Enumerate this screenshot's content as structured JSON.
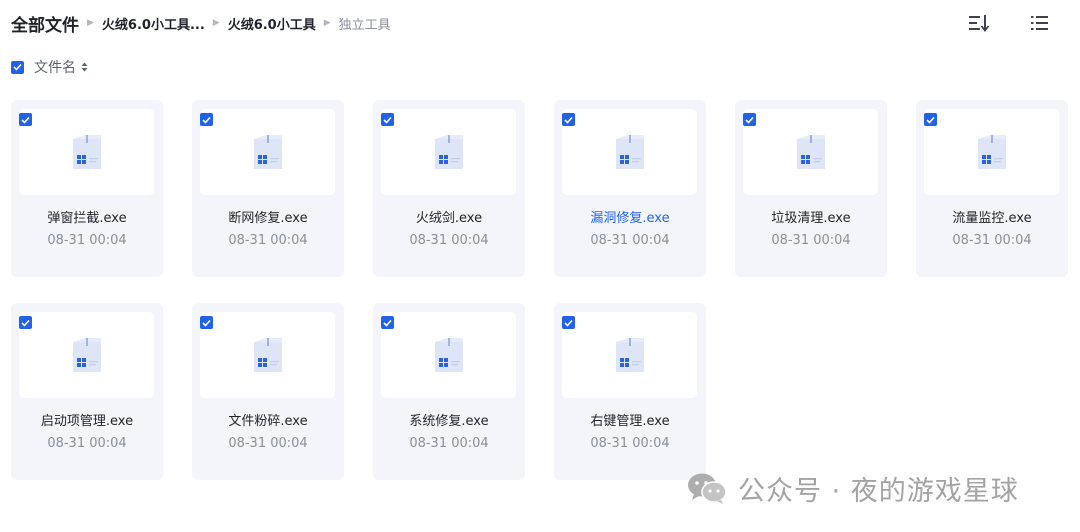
{
  "breadcrumb": {
    "root": "全部文件",
    "items": [
      "火绒6.0小工具...",
      "火绒6.0小工具",
      "独立工具"
    ]
  },
  "toolbar": {
    "sort_icon": "sort-order-icon",
    "view_icon": "list-view-icon"
  },
  "list_header": {
    "checkbox_checked": true,
    "column_label": "文件名"
  },
  "colors": {
    "accent": "#2162e8",
    "card_bg": "#f3f5fb",
    "muted_text": "#8a8f99"
  },
  "files": [
    {
      "name": "弹窗拦截.exe",
      "date": "08-31 00:04",
      "checked": true
    },
    {
      "name": "断网修复.exe",
      "date": "08-31 00:04",
      "checked": true
    },
    {
      "name": "火绒剑.exe",
      "date": "08-31 00:04",
      "checked": true
    },
    {
      "name": "漏洞修复.exe",
      "date": "08-31 00:04",
      "checked": true,
      "highlighted": true
    },
    {
      "name": "垃圾清理.exe",
      "date": "08-31 00:04",
      "checked": true
    },
    {
      "name": "流量监控.exe",
      "date": "08-31 00:04",
      "checked": true
    },
    {
      "name": "启动项管理.exe",
      "date": "08-31 00:04",
      "checked": true
    },
    {
      "name": "文件粉碎.exe",
      "date": "08-31 00:04",
      "checked": true
    },
    {
      "name": "系统修复.exe",
      "date": "08-31 00:04",
      "checked": true
    },
    {
      "name": "右键管理.exe",
      "date": "08-31 00:04",
      "checked": true
    }
  ],
  "watermark": {
    "text": "公众号 · 夜的游戏星球"
  }
}
